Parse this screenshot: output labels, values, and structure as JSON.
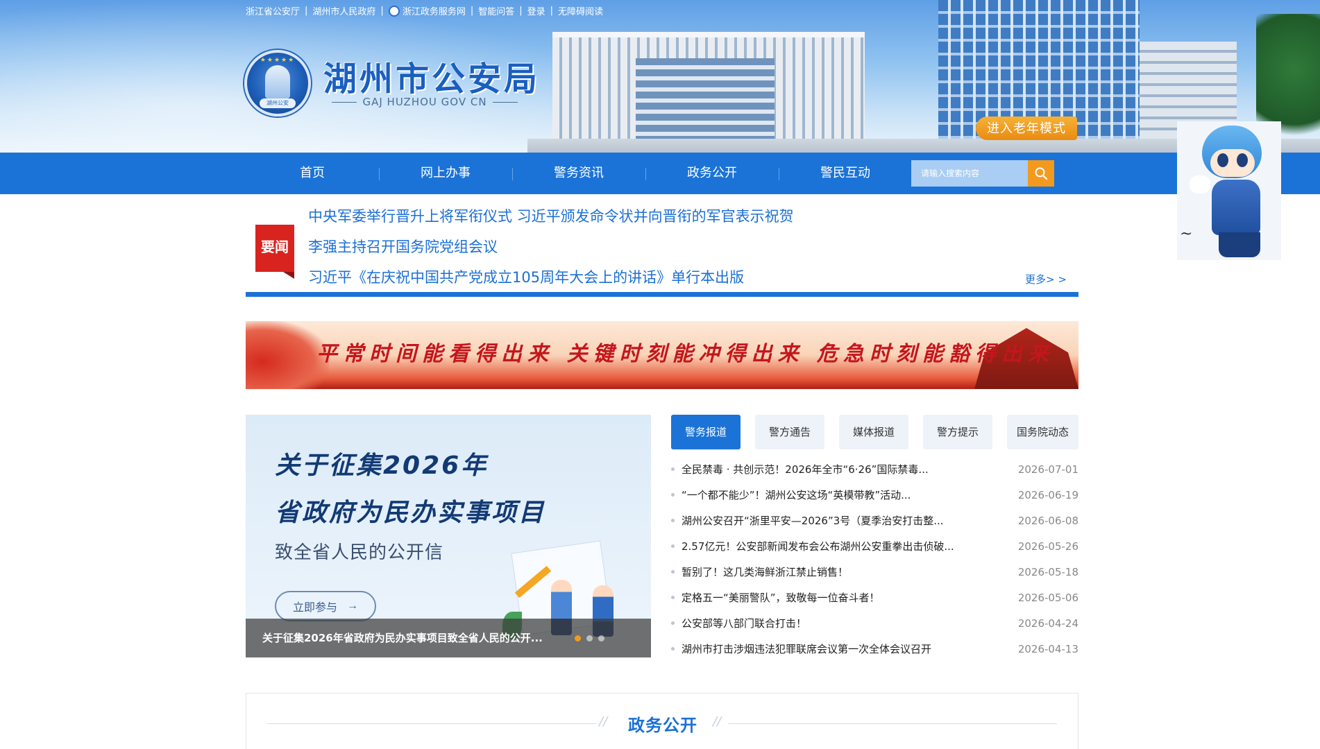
{
  "topbar": {
    "links": [
      "浙江省公安厅",
      "湖州市人民政府",
      "浙江政务服务网",
      "智能问答",
      "登录",
      "无障碍阅读"
    ]
  },
  "site": {
    "title": "湖州市公安局",
    "subtitle": "GAJ HUZHOU GOV CN",
    "emblem_text": "湖州公安",
    "elder_mode": "进入老年模式"
  },
  "nav": {
    "items": [
      "首页",
      "网上办事",
      "警务资讯",
      "政务公开",
      "警民互动"
    ],
    "search_placeholder": "请输入搜索内容"
  },
  "headlines": {
    "badge": "要闻",
    "items": [
      "中央军委举行晋升上将军衔仪式 习近平颁发命令状并向晋衔的军官表示祝贺",
      "李强主持召开国务院党组会议",
      "习近平《在庆祝中国共产党成立105周年大会上的讲话》单行本出版"
    ],
    "more": "更多> >"
  },
  "banner": {
    "text": "平常时间能看得出来 关键时刻能冲得出来 危急时刻能豁得出来"
  },
  "feature": {
    "title_line1": "关于征集2026年",
    "title_line2": "省政府为民办实事项目",
    "subtitle": "致全省人民的公开信",
    "button": "立即参与",
    "caption": "关于征集2026年省政府为民办实事项目致全省人民的公开..."
  },
  "news": {
    "tabs": [
      "警务报道",
      "警方通告",
      "媒体报道",
      "警方提示",
      "国务院动态"
    ],
    "active_tab": 0,
    "items": [
      {
        "title": "全民禁毒 · 共创示范！2026年全市“6·26”国际禁毒...",
        "date": "2026-07-01"
      },
      {
        "title": "“一个都不能少”！湖州公安这场“英模带教”活动...",
        "date": "2026-06-19"
      },
      {
        "title": "湖州公安召开“浙里平安—2026”3号（夏季治安打击整...",
        "date": "2026-06-08"
      },
      {
        "title": "2.57亿元！公安部新闻发布会公布湖州公安重拳出击侦破...",
        "date": "2026-05-26"
      },
      {
        "title": "暂别了！这几类海鲜浙江禁止销售！",
        "date": "2026-05-18"
      },
      {
        "title": "定格五一“美丽警队”，致敬每一位奋斗者！",
        "date": "2026-05-06"
      },
      {
        "title": "公安部等八部门联合打击！",
        "date": "2026-04-24"
      },
      {
        "title": "湖州市打击涉烟违法犯罪联席会议第一次全体会议召开",
        "date": "2026-04-13"
      }
    ]
  },
  "section": {
    "title": "政务公开"
  },
  "colors": {
    "primary": "#1b73d8",
    "accent": "#f39a1e",
    "badge": "#d8231f"
  }
}
